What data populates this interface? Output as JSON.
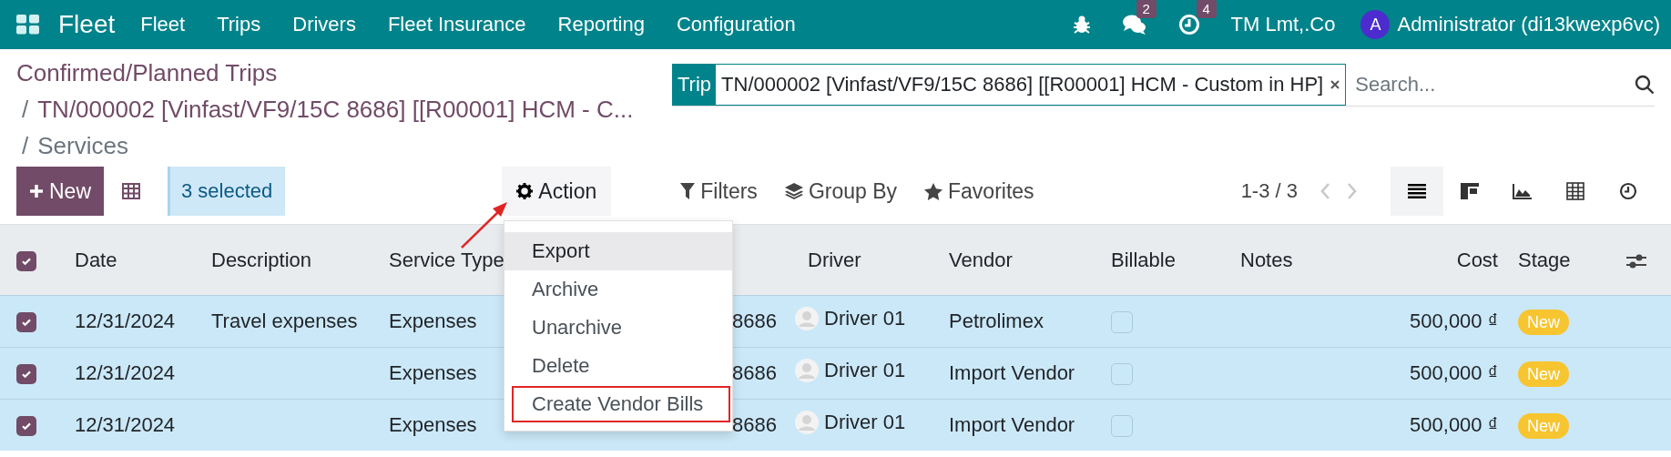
{
  "navbar": {
    "app_name": "Fleet",
    "menus": [
      "Fleet",
      "Trips",
      "Drivers",
      "Fleet Insurance",
      "Reporting",
      "Configuration"
    ],
    "messages_count": "2",
    "activities_count": "4",
    "company": "TM Lmt,.Co",
    "user": {
      "initial": "A",
      "name": "Administrator (di13kwexp6vc)"
    }
  },
  "breadcrumbs": [
    {
      "label": "Confirmed/Planned Trips"
    },
    {
      "separator": "/",
      "label": "TN/000002 [Vinfast/VF9/15C 8686] [[R00001] HCM - C..."
    },
    {
      "separator": "/",
      "label": "Services"
    }
  ],
  "search": {
    "facet_label": "Trip",
    "facet_value": "TN/000002 [Vinfast/VF9/15C 8686] [[R00001] HCM - Custom in HP]",
    "placeholder": "Search..."
  },
  "toolbar": {
    "new_label": "New",
    "selection": "3 selected",
    "action_label": "Action",
    "filters": "Filters",
    "group_by": "Group By",
    "favorites": "Favorites",
    "pager": "1-3 / 3",
    "views": [
      {
        "kind": "list",
        "selected": true
      },
      {
        "kind": "kanban",
        "selected": false
      },
      {
        "kind": "graph",
        "selected": false
      },
      {
        "kind": "pivot",
        "selected": false
      },
      {
        "kind": "activity",
        "selected": false
      }
    ]
  },
  "action_menu": [
    {
      "label": "Export",
      "selected": true,
      "boxed": false
    },
    {
      "label": "Archive",
      "selected": false,
      "boxed": false
    },
    {
      "label": "Unarchive",
      "selected": false,
      "boxed": false
    },
    {
      "label": "Delete",
      "selected": false,
      "boxed": false
    },
    {
      "label": "Create Vendor Bills",
      "selected": false,
      "boxed": true
    }
  ],
  "table": {
    "all_checked": true,
    "columns": [
      {
        "kind": "text",
        "label": "Date"
      },
      {
        "kind": "text",
        "label": "Description"
      },
      {
        "kind": "text",
        "label": "Service Type"
      },
      {
        "kind": "covered"
      },
      {
        "kind": "person",
        "label": "Driver"
      },
      {
        "kind": "text",
        "label": "Vendor"
      },
      {
        "kind": "checkbox",
        "label": "Billable"
      },
      {
        "kind": "text",
        "label": "Notes"
      },
      {
        "kind": "money",
        "label": "Cost"
      },
      {
        "kind": "badge",
        "label": "Stage"
      }
    ],
    "rows": [
      {
        "checked": true,
        "cells": [
          "12/31/2024",
          "Travel expenses",
          "Expenses",
          "8686",
          "Driver 01",
          "Petrolimex",
          false,
          null,
          "500,000 ₫",
          "New"
        ]
      },
      {
        "checked": true,
        "cells": [
          "12/31/2024",
          null,
          "Expenses",
          "8686",
          "Driver 01",
          "Import Vendor",
          false,
          null,
          "500,000 ₫",
          "New"
        ]
      },
      {
        "checked": true,
        "cells": [
          "12/31/2024",
          null,
          "Expenses",
          "8686",
          "Driver 01",
          "Import Vendor",
          false,
          null,
          "500,000 ₫",
          "New"
        ]
      }
    ]
  }
}
